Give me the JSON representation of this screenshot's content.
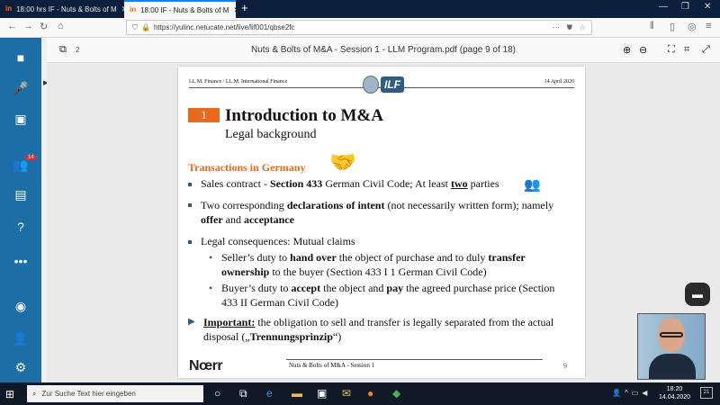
{
  "browser": {
    "tabs": [
      {
        "label": "18:00 hrs IF - Nuts & Bolts of M",
        "favicon": "in"
      },
      {
        "label": "18:00 IF - Nuts & Bolts of M",
        "favicon": "in"
      }
    ],
    "new_tab_icon": "+",
    "url": "https://yulinc.netucate.net/live/lif001/qbse2fc"
  },
  "sidebar": {
    "participants_badge": "14"
  },
  "viewer": {
    "page_count_indicator": "2",
    "title": "Nuts & Bolts of M&A - Session 1 - LLM Program.pdf (page 9 of 18)"
  },
  "slide": {
    "header_left": "LL.M. Finance / LL.M. International Finance",
    "header_right": "14 April 2020",
    "logo_text": "ILF",
    "section_number": "1",
    "title": "Introduction to M&A",
    "subtitle": "Legal background",
    "section_heading": "Transactions in Germany",
    "bullet1": {
      "pre": "Sales contract - ",
      "b1": "Section 433",
      "mid": " German Civil Code; At least ",
      "b2": "two",
      "post": " parties"
    },
    "bullet2": {
      "pre": "Two corresponding ",
      "b1": "declarations of intent",
      "mid": " (not necessarily written form); namely ",
      "b2": "offer",
      "mid2": " and ",
      "b3": "acceptance"
    },
    "bullet3": "Legal consequences: Mutual claims",
    "sub1": {
      "pre": "Seller’s duty to ",
      "b1": "hand over",
      "mid": " the object of purchase and to duly ",
      "b2": "transfer ownership",
      "post": " to the buyer (Section 433 I 1 German Civil Code)"
    },
    "sub2": {
      "pre": "Buyer’s duty to ",
      "b1": "accept",
      "mid": " the object and ",
      "b2": "pay",
      "post": " the agreed purchase price (Section 433 II German Civil Code)"
    },
    "important": {
      "label": "Important:",
      "text": " the obligation to sell and transfer is legally separated from the actual disposal („",
      "b": "Trennungsprinzip",
      "end": "“)"
    },
    "footer_logo": "Nœrr",
    "footer_text": "Nuts & Bolts of M&A - Session 1",
    "footer_page": "9"
  },
  "taskbar": {
    "search_placeholder": "Zur Suche Text hier eingeben",
    "time": "18:20",
    "date": "14.04.2020",
    "notification_count": "21"
  }
}
